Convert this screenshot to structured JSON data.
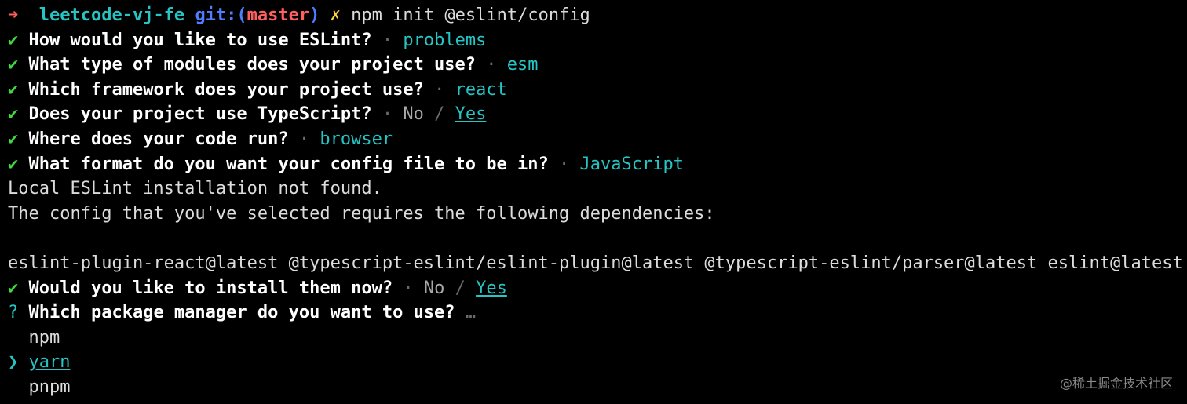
{
  "prompt": {
    "arrow": "➜",
    "dir": "leetcode-vj-fe",
    "git_prefix": "git:(",
    "branch": "master",
    "git_suffix": ")",
    "dirty": "✗",
    "command": "npm init @eslint/config"
  },
  "symbols": {
    "check": "✔",
    "sep": "·",
    "slash": "/",
    "qmark": "?",
    "pointer": "❯"
  },
  "questions": [
    {
      "q": "How would you like to use ESLint?",
      "a": "problems"
    },
    {
      "q": "What type of modules does your project use?",
      "a": "esm"
    },
    {
      "q": "Which framework does your project use?",
      "a": "react"
    },
    {
      "q": "Does your project use TypeScript?",
      "no": "No",
      "yes": "Yes"
    },
    {
      "q": "Where does your code run?",
      "a": "browser"
    },
    {
      "q": "What format do you want your config file to be in?",
      "a": "JavaScript"
    }
  ],
  "messages": {
    "not_found": "Local ESLint installation not found.",
    "requires": "The config that you've selected requires the following dependencies:",
    "deps": "eslint-plugin-react@latest @typescript-eslint/eslint-plugin@latest @typescript-eslint/parser@latest eslint@latest"
  },
  "install_question": {
    "q": "Would you like to install them now?",
    "no": "No",
    "yes": "Yes"
  },
  "pm_question": {
    "q": "Which package manager do you want to use?",
    "ellipsis": "…"
  },
  "pm_options": [
    "npm",
    "yarn",
    "pnpm"
  ],
  "watermark": "@稀土掘金技术社区",
  "colors": {
    "background": "#000000",
    "check": "#3fd83f",
    "answer": "#27c4c4",
    "branch": "#ff5f5f",
    "git": "#4f7dff",
    "dirty": "#ffd23a"
  }
}
